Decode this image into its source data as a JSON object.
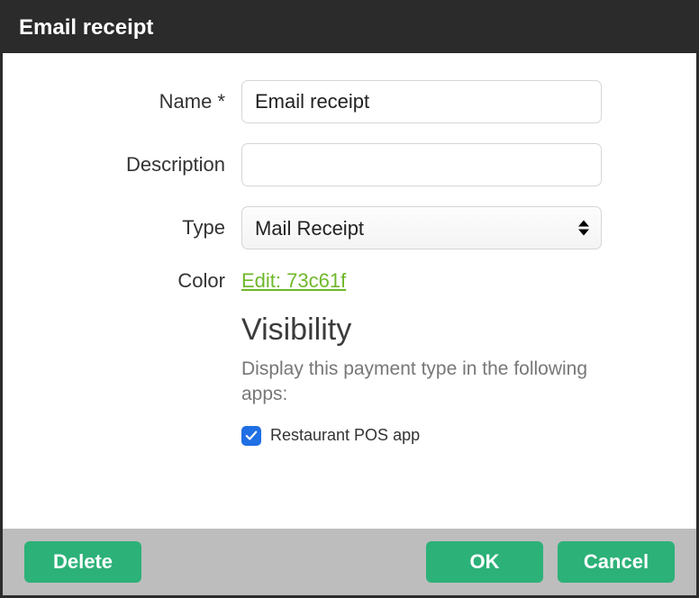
{
  "dialog": {
    "title": "Email receipt"
  },
  "form": {
    "name": {
      "label": "Name *",
      "value": "Email receipt"
    },
    "description": {
      "label": "Description",
      "value": ""
    },
    "type": {
      "label": "Type",
      "selected": "Mail Receipt"
    },
    "color": {
      "label": "Color",
      "link_text": "Edit: 73c61f"
    }
  },
  "visibility": {
    "heading": "Visibility",
    "description": "Display this payment type in the following apps:",
    "option1": {
      "label": "Restaurant POS app",
      "checked": true
    }
  },
  "buttons": {
    "delete": "Delete",
    "ok": "OK",
    "cancel": "Cancel"
  }
}
